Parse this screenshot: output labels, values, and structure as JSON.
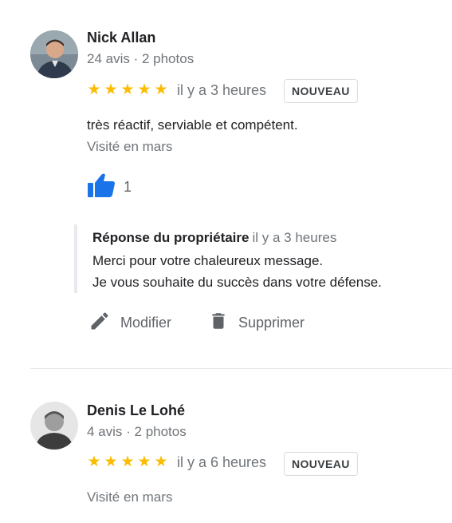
{
  "reviews": [
    {
      "author": "Nick Allan",
      "meta": "24 avis · 2 photos",
      "rating": 5,
      "time": "il y a 3 heures",
      "badge": "NOUVEAU",
      "text": "très réactif, serviable et compétent.",
      "visited": "Visité en mars",
      "likes": "1",
      "reply": {
        "title": "Réponse du propriétaire",
        "time": "il y a 3 heures",
        "lines": [
          "Merci pour votre chaleureux message.",
          "Je vous souhaite du succès dans votre défense."
        ]
      },
      "actions": {
        "edit": "Modifier",
        "delete": "Supprimer"
      }
    },
    {
      "author": "Denis Le Lohé",
      "meta": "4 avis · 2 photos",
      "rating": 5,
      "time": "il y a 6 heures",
      "badge": "NOUVEAU",
      "visited": "Visité en mars"
    }
  ],
  "colors": {
    "star": "#fbbc04",
    "like": "#1a73e8"
  },
  "icons": {
    "star": "star-icon",
    "like": "thumbs-up-icon",
    "edit": "pencil-icon",
    "delete": "trash-icon"
  }
}
